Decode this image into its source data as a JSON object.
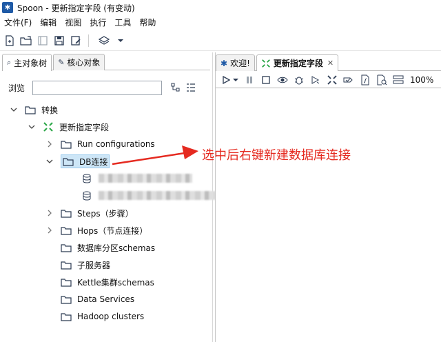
{
  "window": {
    "title": "Spoon - 更新指定字段 (有变动)"
  },
  "menu": [
    "文件(F)",
    "编辑",
    "视图",
    "执行",
    "工具",
    "帮助"
  ],
  "toolbar": {
    "icons": [
      "new-file-icon",
      "open-folder-icon",
      "explore-repository-icon",
      "save-icon",
      "save-as-icon",
      "layers-icon",
      "dropdown-icon"
    ]
  },
  "left_panel": {
    "tabs": [
      {
        "label": "主对象树",
        "icon": "tree-icon",
        "active": true
      },
      {
        "label": "核心对象",
        "icon": "pencil-icon",
        "active": false
      }
    ],
    "browse_label": "浏览",
    "browse_value": ""
  },
  "tree": {
    "root": "转换",
    "transform": "更新指定字段",
    "items": {
      "run_configurations": "Run configurations",
      "db_connections": "DB连接",
      "steps": "Steps（步骤）",
      "hops": "Hops（节点连接）",
      "partition_schemas": "数据库分区schemas",
      "sub_servers": "子服务器",
      "kettle_cluster": "Kettle集群schemas",
      "data_services": "Data Services",
      "hadoop_clusters": "Hadoop clusters"
    }
  },
  "right_panel": {
    "tabs": [
      {
        "label": "欢迎!",
        "active": false
      },
      {
        "label": "更新指定字段",
        "active": true,
        "closable": true
      }
    ],
    "run_toolbar_icons": [
      "run-icon",
      "run-dropdown-icon",
      "pause-icon",
      "stop-icon",
      "preview-icon",
      "debug-icon",
      "replay-icon",
      "verify-icon",
      "impact-icon",
      "sql-icon",
      "explore-db-icon",
      "show-results-icon"
    ],
    "zoom": "100%"
  },
  "annotation": {
    "text": "选中后右键新建数据库连接",
    "color": "#e52a20"
  }
}
